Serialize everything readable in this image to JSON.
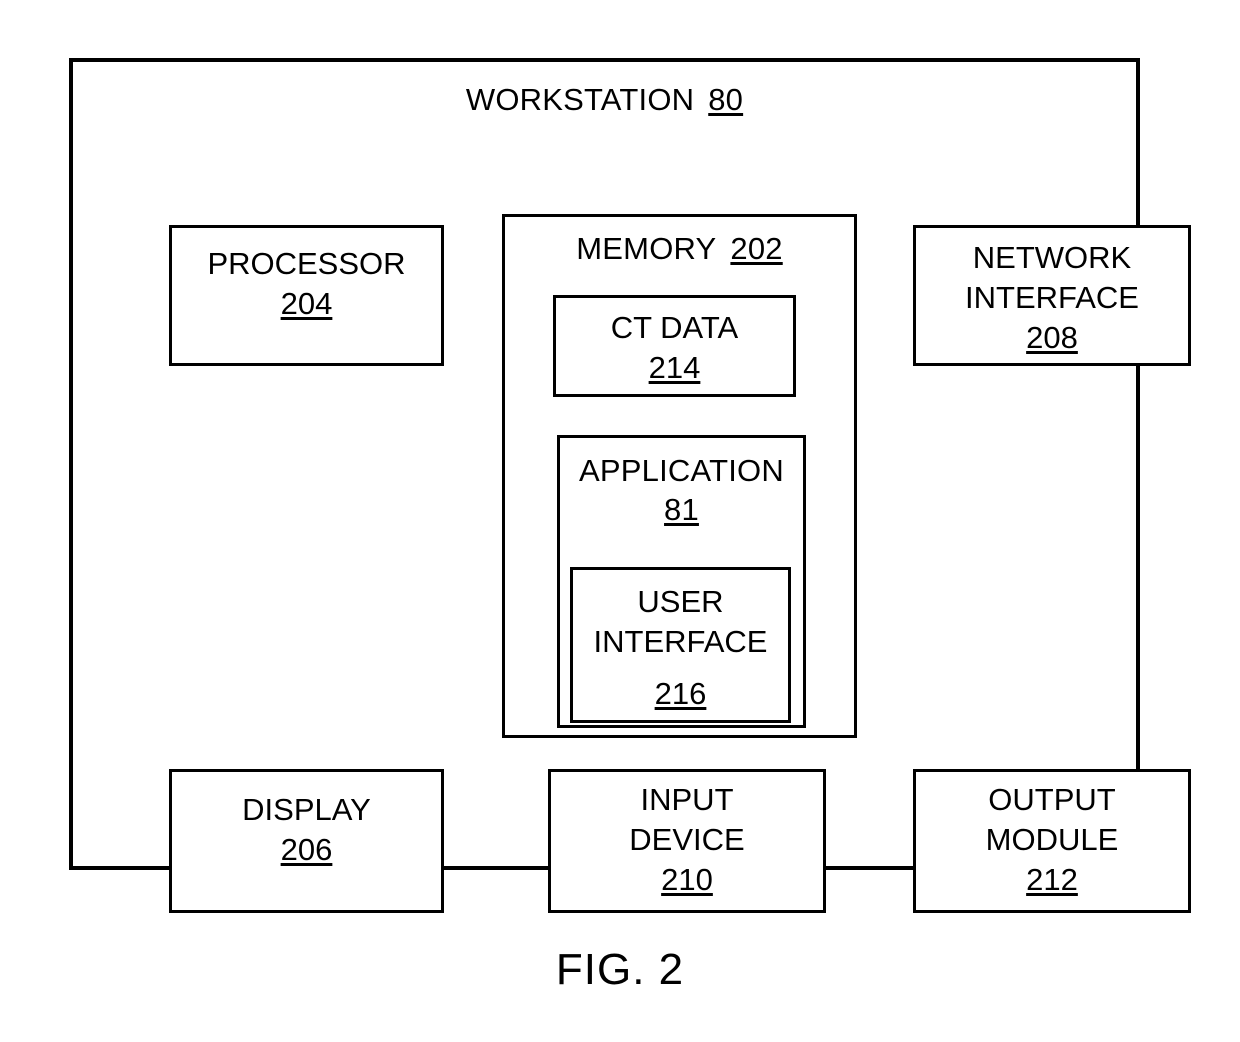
{
  "figure": {
    "caption": "FIG. 2",
    "workstation": {
      "title": "WORKSTATION",
      "ref": "80",
      "components": {
        "processor": {
          "label": "PROCESSOR",
          "ref": "204"
        },
        "network_interface": {
          "label_line1": "NETWORK",
          "label_line2": "INTERFACE",
          "ref": "208"
        },
        "memory": {
          "title": "MEMORY",
          "ref": "202",
          "ct_data": {
            "label": "CT DATA",
            "ref": "214"
          },
          "application": {
            "title": "APPLICATION",
            "ref": "81",
            "user_interface": {
              "label_line1": "USER",
              "label_line2": "INTERFACE",
              "ref": "216"
            }
          }
        },
        "display": {
          "label": "DISPLAY",
          "ref": "206"
        },
        "input_device": {
          "label_line1": "INPUT",
          "label_line2": "DEVICE",
          "ref": "210"
        },
        "output_module": {
          "label_line1": "OUTPUT",
          "label_line2": "MODULE",
          "ref": "212"
        }
      }
    }
  }
}
